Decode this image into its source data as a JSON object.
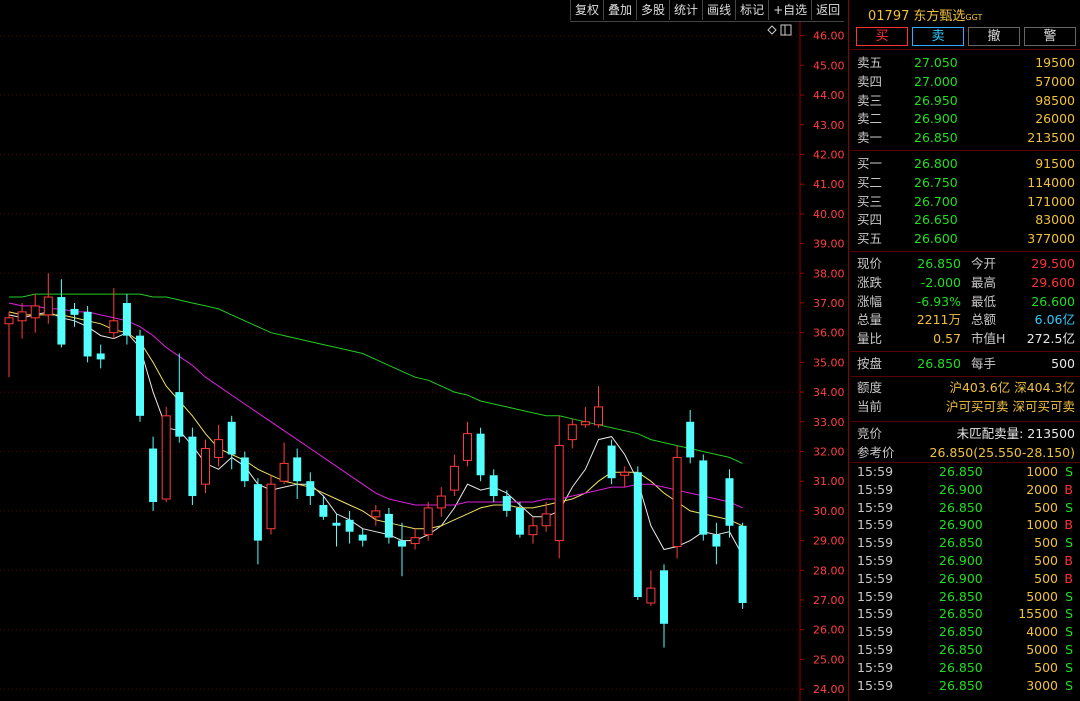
{
  "toolbar": {
    "items": [
      "复权",
      "叠加",
      "多股",
      "统计",
      "画线",
      "标记",
      "+自选",
      "返回"
    ]
  },
  "chart_icons": {
    "diamond": "diamond-icon",
    "panel": "panel-toggle-icon"
  },
  "chart_data": {
    "type": "candlestick",
    "title": "",
    "y_ticks": [
      "46.00",
      "45.00",
      "44.00",
      "43.00",
      "42.00",
      "41.00",
      "40.00",
      "39.00",
      "38.00",
      "37.00",
      "36.00",
      "35.00",
      "34.00",
      "33.00",
      "32.00",
      "31.00",
      "30.00",
      "29.00",
      "28.00",
      "27.00",
      "26.00",
      "25.00",
      "24.00"
    ],
    "ylim": [
      23.6,
      47.2
    ],
    "grid": true,
    "candles": [
      {
        "o": 36.3,
        "c": 36.5,
        "h": 36.7,
        "l": 34.5
      },
      {
        "o": 36.4,
        "c": 36.7,
        "h": 37.0,
        "l": 35.8
      },
      {
        "o": 36.5,
        "c": 36.9,
        "h": 37.3,
        "l": 36.0
      },
      {
        "o": 36.6,
        "c": 37.2,
        "h": 38.0,
        "l": 36.3
      },
      {
        "o": 37.2,
        "c": 35.6,
        "h": 37.8,
        "l": 35.5
      },
      {
        "o": 36.8,
        "c": 36.6,
        "h": 37.0,
        "l": 36.2
      },
      {
        "o": 36.7,
        "c": 35.2,
        "h": 36.9,
        "l": 35.0
      },
      {
        "o": 35.3,
        "c": 35.1,
        "h": 35.6,
        "l": 34.8
      },
      {
        "o": 36.0,
        "c": 36.4,
        "h": 37.5,
        "l": 35.8
      },
      {
        "o": 37.0,
        "c": 35.9,
        "h": 37.3,
        "l": 35.6
      },
      {
        "o": 35.9,
        "c": 33.2,
        "h": 36.1,
        "l": 33.0
      },
      {
        "o": 32.1,
        "c": 30.3,
        "h": 32.5,
        "l": 30.0
      },
      {
        "o": 30.4,
        "c": 33.2,
        "h": 33.5,
        "l": 30.3
      },
      {
        "o": 34.0,
        "c": 32.5,
        "h": 35.3,
        "l": 32.3
      },
      {
        "o": 32.5,
        "c": 30.5,
        "h": 32.8,
        "l": 30.2
      },
      {
        "o": 30.9,
        "c": 32.1,
        "h": 32.4,
        "l": 30.6
      },
      {
        "o": 31.8,
        "c": 32.4,
        "h": 32.9,
        "l": 31.5
      },
      {
        "o": 33.0,
        "c": 31.9,
        "h": 33.2,
        "l": 31.4
      },
      {
        "o": 31.8,
        "c": 31.0,
        "h": 32.0,
        "l": 30.8
      },
      {
        "o": 30.9,
        "c": 29.0,
        "h": 31.1,
        "l": 28.2
      },
      {
        "o": 29.4,
        "c": 30.9,
        "h": 31.2,
        "l": 29.2
      },
      {
        "o": 31.0,
        "c": 31.6,
        "h": 32.3,
        "l": 30.9
      },
      {
        "o": 31.8,
        "c": 31.0,
        "h": 32.1,
        "l": 30.4
      },
      {
        "o": 31.0,
        "c": 30.5,
        "h": 31.3,
        "l": 30.2
      },
      {
        "o": 30.2,
        "c": 29.8,
        "h": 30.5,
        "l": 29.7
      },
      {
        "o": 29.6,
        "c": 29.5,
        "h": 29.9,
        "l": 28.8
      },
      {
        "o": 29.7,
        "c": 29.3,
        "h": 30.0,
        "l": 28.9
      },
      {
        "o": 29.2,
        "c": 29.0,
        "h": 29.4,
        "l": 28.8
      },
      {
        "o": 29.8,
        "c": 30.0,
        "h": 30.2,
        "l": 29.5
      },
      {
        "o": 29.9,
        "c": 29.1,
        "h": 30.1,
        "l": 28.9
      },
      {
        "o": 29.0,
        "c": 28.8,
        "h": 29.6,
        "l": 27.8
      },
      {
        "o": 28.9,
        "c": 29.1,
        "h": 29.4,
        "l": 28.7
      },
      {
        "o": 29.2,
        "c": 30.1,
        "h": 30.3,
        "l": 29.0
      },
      {
        "o": 30.1,
        "c": 30.5,
        "h": 30.8,
        "l": 29.8
      },
      {
        "o": 30.7,
        "c": 31.5,
        "h": 31.9,
        "l": 30.5
      },
      {
        "o": 31.7,
        "c": 32.6,
        "h": 33.0,
        "l": 31.5
      },
      {
        "o": 32.6,
        "c": 31.2,
        "h": 32.8,
        "l": 31.0
      },
      {
        "o": 31.2,
        "c": 30.5,
        "h": 31.4,
        "l": 30.3
      },
      {
        "o": 30.5,
        "c": 30.0,
        "h": 30.7,
        "l": 29.8
      },
      {
        "o": 30.1,
        "c": 29.2,
        "h": 30.3,
        "l": 29.1
      },
      {
        "o": 29.2,
        "c": 29.5,
        "h": 29.8,
        "l": 28.9
      },
      {
        "o": 29.5,
        "c": 29.9,
        "h": 30.3,
        "l": 29.3
      },
      {
        "o": 29.0,
        "c": 32.2,
        "h": 33.2,
        "l": 28.4
      },
      {
        "o": 32.4,
        "c": 32.9,
        "h": 33.1,
        "l": 32.1
      },
      {
        "o": 32.9,
        "c": 33.0,
        "h": 33.5,
        "l": 32.8
      },
      {
        "o": 32.9,
        "c": 33.5,
        "h": 34.2,
        "l": 32.8
      },
      {
        "o": 32.2,
        "c": 31.1,
        "h": 32.4,
        "l": 30.9
      },
      {
        "o": 31.2,
        "c": 31.3,
        "h": 31.5,
        "l": 30.8
      },
      {
        "o": 31.3,
        "c": 27.1,
        "h": 31.5,
        "l": 27.0
      },
      {
        "o": 26.9,
        "c": 27.4,
        "h": 28.0,
        "l": 26.8
      },
      {
        "o": 28.0,
        "c": 26.2,
        "h": 28.2,
        "l": 25.4
      },
      {
        "o": 28.8,
        "c": 31.8,
        "h": 32.2,
        "l": 28.4
      },
      {
        "o": 33.0,
        "c": 31.8,
        "h": 33.4,
        "l": 31.6
      },
      {
        "o": 31.7,
        "c": 29.2,
        "h": 31.9,
        "l": 29.0
      },
      {
        "o": 29.2,
        "c": 28.8,
        "h": 29.6,
        "l": 28.2
      },
      {
        "o": 31.1,
        "c": 29.5,
        "h": 31.4,
        "l": 29.1
      },
      {
        "o": 29.5,
        "c": 26.9,
        "h": 29.6,
        "l": 26.7
      }
    ],
    "ma_series": [
      {
        "color": "#e8e8e8",
        "values": [
          36.6,
          36.5,
          36.6,
          36.7,
          36.5,
          36.4,
          36.2,
          35.9,
          35.8,
          36.0,
          35.5,
          34.0,
          32.8,
          32.7,
          32.2,
          31.6,
          31.4,
          31.8,
          31.5,
          30.9,
          30.7,
          30.8,
          30.9,
          30.9,
          30.5,
          29.9,
          29.7,
          29.4,
          29.3,
          29.2,
          29.0,
          29.0,
          29.2,
          29.5,
          30.1,
          30.9,
          30.7,
          30.8,
          30.6,
          30.2,
          29.8,
          29.8,
          30.0,
          30.8,
          31.4,
          32.4,
          32.5,
          31.9,
          31.0,
          29.5,
          28.7,
          28.8,
          29.0,
          29.3,
          29.2,
          29.3,
          28.5
        ]
      },
      {
        "color": "#f0e060",
        "values": [
          36.7,
          36.6,
          36.6,
          36.6,
          36.6,
          36.5,
          36.4,
          36.3,
          36.1,
          36.0,
          35.7,
          35.0,
          34.2,
          33.7,
          33.2,
          32.6,
          32.1,
          31.9,
          31.7,
          31.4,
          31.2,
          31.0,
          30.9,
          30.8,
          30.6,
          30.4,
          30.2,
          30.0,
          29.7,
          29.6,
          29.5,
          29.4,
          29.4,
          29.5,
          29.7,
          29.9,
          30.1,
          30.2,
          30.2,
          30.1,
          30.1,
          30.2,
          30.3,
          30.4,
          30.6,
          31.0,
          31.3,
          31.3,
          31.3,
          31.0,
          30.6,
          30.3,
          30.0,
          29.9,
          29.8,
          29.7,
          29.5
        ]
      },
      {
        "color": "#dd22dd",
        "values": [
          37.0,
          36.9,
          36.9,
          36.8,
          36.8,
          36.7,
          36.7,
          36.6,
          36.5,
          36.4,
          36.2,
          35.9,
          35.5,
          35.2,
          34.9,
          34.5,
          34.2,
          33.9,
          33.6,
          33.3,
          33.0,
          32.7,
          32.4,
          32.1,
          31.8,
          31.5,
          31.2,
          30.9,
          30.6,
          30.4,
          30.3,
          30.2,
          30.2,
          30.2,
          30.2,
          30.3,
          30.3,
          30.3,
          30.3,
          30.3,
          30.3,
          30.4,
          30.4,
          30.5,
          30.6,
          30.7,
          30.8,
          30.8,
          30.9,
          30.9,
          30.8,
          30.7,
          30.6,
          30.5,
          30.4,
          30.3,
          30.1
        ]
      },
      {
        "color": "#22cc22",
        "values": [
          37.2,
          37.2,
          37.3,
          37.3,
          37.3,
          37.3,
          37.3,
          37.3,
          37.3,
          37.3,
          37.3,
          37.2,
          37.2,
          37.1,
          37.0,
          36.9,
          36.8,
          36.6,
          36.4,
          36.2,
          36.0,
          35.9,
          35.8,
          35.7,
          35.6,
          35.5,
          35.4,
          35.3,
          35.1,
          34.9,
          34.7,
          34.5,
          34.4,
          34.2,
          34.0,
          33.9,
          33.7,
          33.6,
          33.5,
          33.4,
          33.3,
          33.2,
          33.2,
          33.1,
          33.0,
          32.9,
          32.8,
          32.7,
          32.6,
          32.4,
          32.3,
          32.2,
          32.1,
          32.0,
          31.9,
          31.8,
          31.6
        ]
      }
    ]
  },
  "stock": {
    "code": "01797",
    "name": "东方甄选",
    "suffix": "GGT"
  },
  "actions": [
    "买",
    "卖",
    "撤",
    "警"
  ],
  "asks": [
    {
      "label": "卖五",
      "price": "27.050",
      "vol": "19500"
    },
    {
      "label": "卖四",
      "price": "27.000",
      "vol": "57000"
    },
    {
      "label": "卖三",
      "price": "26.950",
      "vol": "98500"
    },
    {
      "label": "卖二",
      "price": "26.900",
      "vol": "26000"
    },
    {
      "label": "卖一",
      "price": "26.850",
      "vol": "213500"
    }
  ],
  "bids": [
    {
      "label": "买一",
      "price": "26.800",
      "vol": "91500"
    },
    {
      "label": "买二",
      "price": "26.750",
      "vol": "114000"
    },
    {
      "label": "买三",
      "price": "26.700",
      "vol": "171000"
    },
    {
      "label": "买四",
      "price": "26.650",
      "vol": "83000"
    },
    {
      "label": "买五",
      "price": "26.600",
      "vol": "377000"
    }
  ],
  "stats": [
    {
      "l1": "现价",
      "v1": "26.850",
      "c1": "green",
      "l2": "今开",
      "v2": "29.500",
      "c2": "red"
    },
    {
      "l1": "涨跌",
      "v1": "-2.000",
      "c1": "green",
      "l2": "最高",
      "v2": "29.600",
      "c2": "red"
    },
    {
      "l1": "涨幅",
      "v1": "-6.93%",
      "c1": "green",
      "l2": "最低",
      "v2": "26.600",
      "c2": "green"
    },
    {
      "l1": "总量",
      "v1": "2211万",
      "c1": "yellow",
      "l2": "总额",
      "v2": "6.06亿",
      "c2": "cyan"
    },
    {
      "l1": "量比",
      "v1": "0.57",
      "c1": "yellow",
      "l2": "市值H",
      "v2": "272.5亿",
      "c2": "white"
    }
  ],
  "close_row": {
    "l1": "按盘",
    "v1": "26.850",
    "l2": "每手",
    "v2": "500"
  },
  "quota": {
    "label": "额度",
    "value": "沪403.6亿 深404.3亿"
  },
  "current": {
    "label": "当前",
    "value": "沪可买可卖 深可买可卖"
  },
  "auction": {
    "label": "竞价",
    "value": "未匹配卖量: 213500"
  },
  "ref_price": {
    "label": "参考价",
    "value": "26.850(25.550-28.150)"
  },
  "trades": [
    {
      "time": "15:59",
      "price": "26.850",
      "vol": "1000",
      "side": "S"
    },
    {
      "time": "15:59",
      "price": "26.900",
      "vol": "2000",
      "side": "B"
    },
    {
      "time": "15:59",
      "price": "26.850",
      "vol": "500",
      "side": "S"
    },
    {
      "time": "15:59",
      "price": "26.900",
      "vol": "1000",
      "side": "B"
    },
    {
      "time": "15:59",
      "price": "26.850",
      "vol": "500",
      "side": "S"
    },
    {
      "time": "15:59",
      "price": "26.900",
      "vol": "500",
      "side": "B"
    },
    {
      "time": "15:59",
      "price": "26.900",
      "vol": "500",
      "side": "B"
    },
    {
      "time": "15:59",
      "price": "26.850",
      "vol": "5000",
      "side": "S"
    },
    {
      "time": "15:59",
      "price": "26.850",
      "vol": "15500",
      "side": "S"
    },
    {
      "time": "15:59",
      "price": "26.850",
      "vol": "4000",
      "side": "S"
    },
    {
      "time": "15:59",
      "price": "26.850",
      "vol": "5000",
      "side": "S"
    },
    {
      "time": "15:59",
      "price": "26.850",
      "vol": "500",
      "side": "S"
    },
    {
      "time": "15:59",
      "price": "26.850",
      "vol": "3000",
      "side": "S"
    }
  ]
}
